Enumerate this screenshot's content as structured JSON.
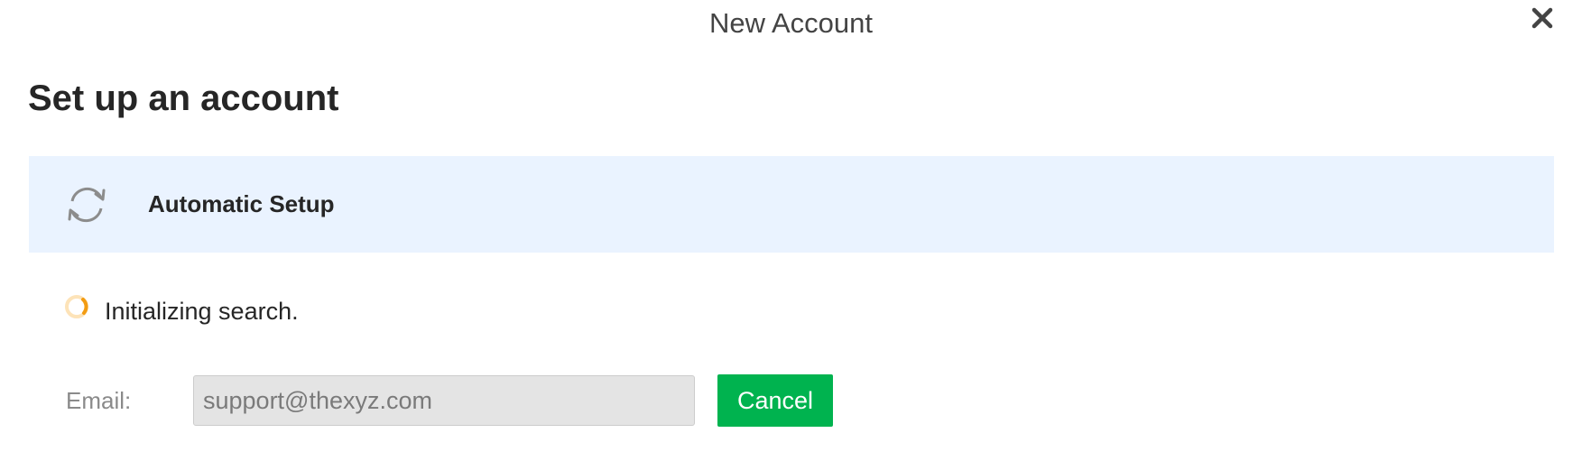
{
  "window": {
    "title": "New Account",
    "close_icon": "close-icon"
  },
  "page": {
    "heading": "Set up an account"
  },
  "setup_panel": {
    "icon": "refresh-icon",
    "label": "Automatic Setup",
    "background_color": "#eaf3ff"
  },
  "status": {
    "icon": "loading-spinner-icon",
    "text": "Initializing search.",
    "spinner_color": "#f39c12"
  },
  "form": {
    "email_label": "Email:",
    "email_value": "support@thexyz.com",
    "cancel_label": "Cancel",
    "cancel_color": "#00b34f"
  }
}
